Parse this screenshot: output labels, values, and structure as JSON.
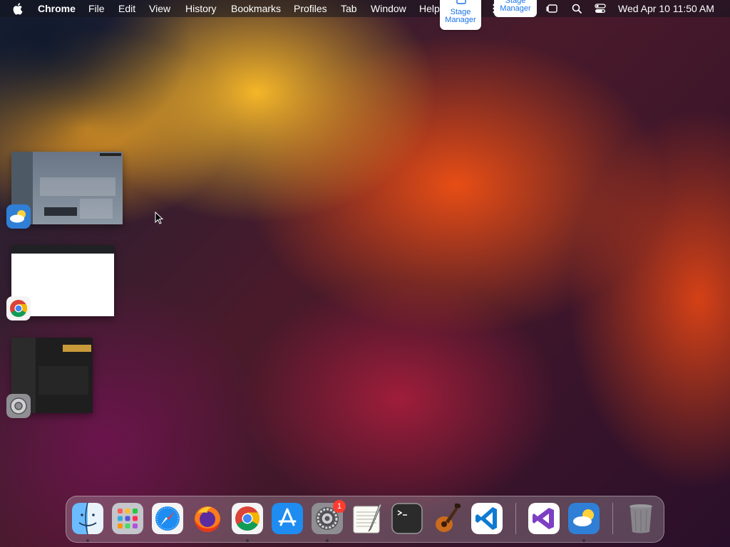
{
  "menubar": {
    "app_name": "Chrome",
    "items": [
      "File",
      "Edit",
      "View",
      "History",
      "Bookmarks",
      "Profiles",
      "Tab",
      "Window",
      "Help"
    ],
    "clock": "Wed Apr 10  11:50 AM"
  },
  "stage_manager": {
    "tile_line1": "Stage",
    "tile_line2": "Manager",
    "small_label": "Stage\nManager"
  },
  "stage_thumbnails": [
    {
      "app": "Weather"
    },
    {
      "app": "Google Chrome"
    },
    {
      "app": "System Settings"
    }
  ],
  "dock": {
    "apps": [
      "Finder",
      "Launchpad",
      "Safari",
      "Firefox",
      "Google Chrome",
      "App Store",
      "System Settings",
      "TextEdit",
      "Terminal",
      "GarageBand",
      "Visual Studio Code",
      "Visual Studio",
      "Weather",
      "Trash"
    ],
    "system_settings_badge": "1"
  },
  "colors": {
    "menubar_text": "#ffffff",
    "stage_manager_text": "#1a73e8",
    "badge": "#ff3b30"
  }
}
